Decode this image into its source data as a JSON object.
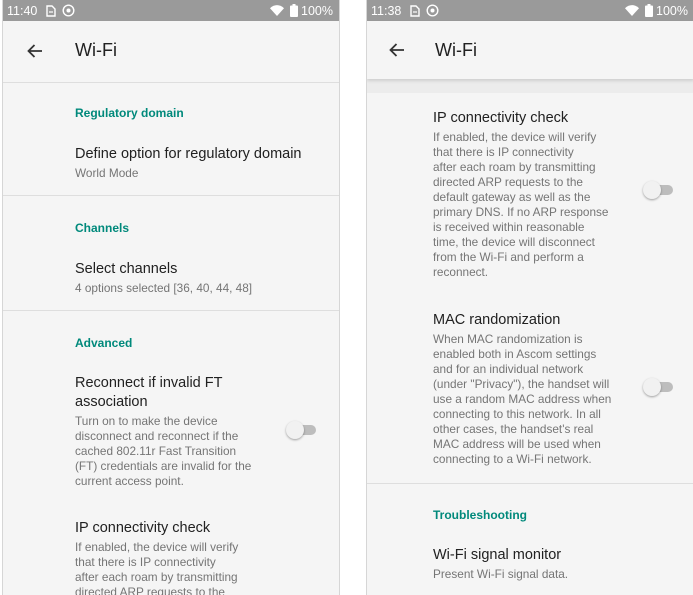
{
  "left_screen": {
    "status": {
      "time": "11:40",
      "battery": "100%"
    },
    "appbar": {
      "title": "Wi-Fi"
    },
    "regulatory_header": "Regulatory domain",
    "regulatory_option": {
      "title": "Define option for regulatory domain",
      "summary": "World Mode"
    },
    "channels_header": "Channels",
    "select_channels": {
      "title": "Select channels",
      "summary": "4 options selected [36, 40, 44, 48]"
    },
    "advanced_header": "Advanced",
    "reconnect_ft": {
      "title_lines": [
        "Reconnect if invalid FT",
        "association"
      ],
      "summary_lines": [
        "Turn on to make the device",
        "disconnect and reconnect if the",
        "cached 802.11r Fast Transition",
        "(FT) credentials are invalid for the",
        "current access point."
      ],
      "enabled": false
    },
    "ip_check": {
      "title": "IP connectivity check",
      "summary_lines": [
        "If enabled, the device will verify",
        "that there is IP connectivity",
        "after each roam by transmitting",
        "directed ARP requests to the"
      ]
    }
  },
  "right_screen": {
    "status": {
      "time": "11:38",
      "battery": "100%"
    },
    "appbar": {
      "title": "Wi-Fi"
    },
    "ip_check": {
      "title": "IP connectivity check",
      "summary_lines": [
        "If enabled, the device will verify",
        "that there is IP connectivity",
        "after each roam by transmitting",
        "directed ARP requests to the",
        "default gateway as well as the",
        "primary DNS. If no ARP response",
        "is received within reasonable",
        "time, the device will disconnect",
        "from the Wi-Fi and perform a",
        "reconnect."
      ],
      "enabled": false
    },
    "mac_random": {
      "title": "MAC randomization",
      "summary_lines": [
        "When MAC randomization is",
        "enabled both in Ascom settings",
        "and for an individual network",
        "(under \"Privacy\"), the handset will",
        "use a random MAC address when",
        "connecting to this network. In all",
        "other cases, the handset's real",
        "MAC address will be used when",
        "connecting to a Wi-Fi network."
      ],
      "enabled": false
    },
    "troubleshooting_header": "Troubleshooting",
    "signal_monitor": {
      "title": "Wi-Fi signal monitor",
      "summary": "Present Wi-Fi signal data."
    }
  },
  "colors": {
    "accent": "#00897b",
    "statusbar": "#9a9a9a",
    "background": "#f5f5f5"
  },
  "icons": [
    "sim-icon",
    "wifi-ap-icon",
    "wifi-signal-icon",
    "battery-icon",
    "back-arrow-icon"
  ]
}
